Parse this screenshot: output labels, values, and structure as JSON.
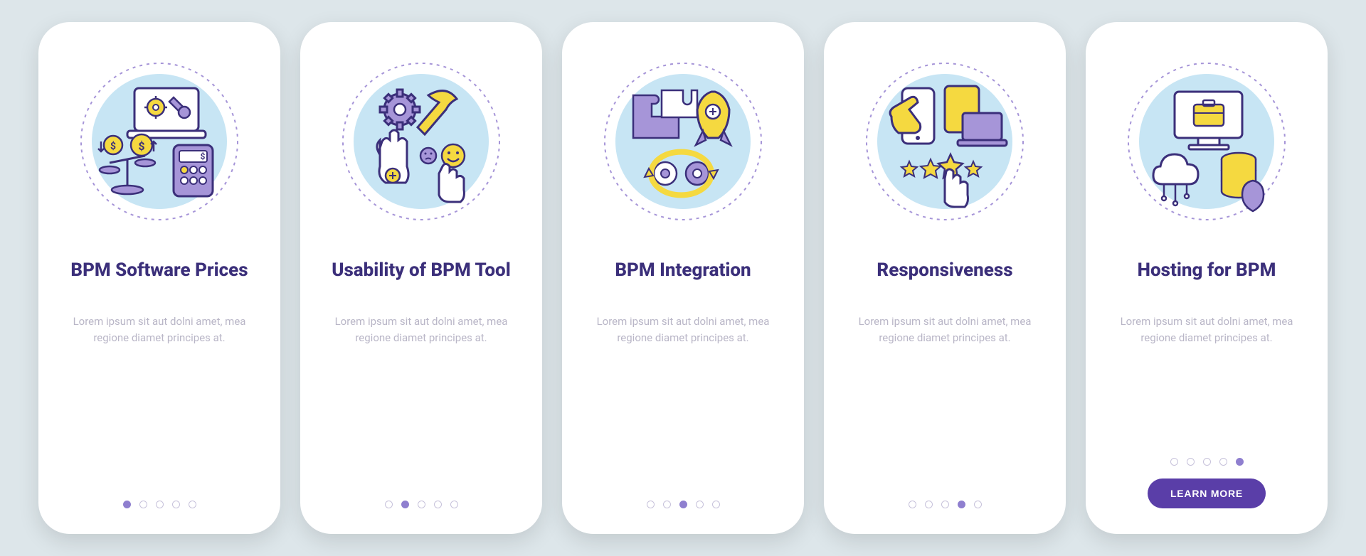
{
  "screens": [
    {
      "title": "BPM Software Prices",
      "desc": "Lorem ipsum sit aut dolni amet, mea regione diamet principes at.",
      "activeDot": 0
    },
    {
      "title": "Usability of BPM Tool",
      "desc": "Lorem ipsum sit aut dolni amet, mea regione diamet principes at.",
      "activeDot": 1
    },
    {
      "title": "BPM Integration",
      "desc": "Lorem ipsum sit aut dolni amet, mea regione diamet principes at.",
      "activeDot": 2
    },
    {
      "title": "Responsiveness",
      "desc": "Lorem ipsum sit aut dolni amet, mea regione diamet principes at.",
      "activeDot": 3
    },
    {
      "title": "Hosting for BPM",
      "desc": "Lorem ipsum sit aut dolni amet, mea regione diamet principes at.",
      "activeDot": 4,
      "hasCta": true
    }
  ],
  "cta_label": "LEARN MORE",
  "dotCount": 5,
  "colors": {
    "purple": "#3b2f7a",
    "lavender": "#a695d8",
    "yellow": "#f5d940",
    "lightblue": "#c7e5f4",
    "grey": "#b9b6c7"
  }
}
